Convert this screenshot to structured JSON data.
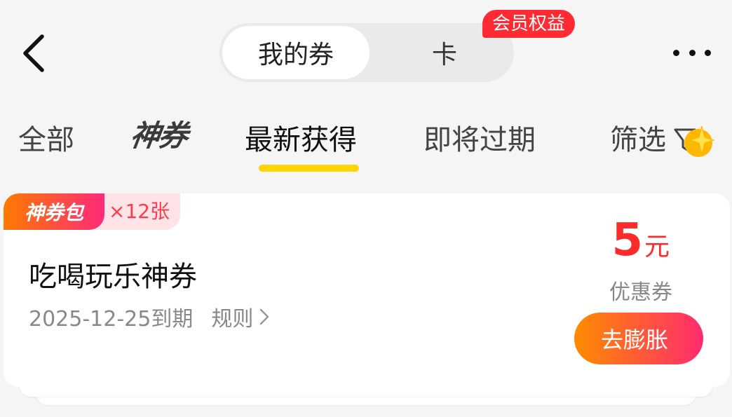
{
  "header": {
    "segments": [
      {
        "label": "我的券",
        "active": true
      },
      {
        "label": "卡",
        "active": false
      }
    ],
    "member_badge": "会员权益"
  },
  "filter_tabs": {
    "all": "全部",
    "god": "神券",
    "newest": "最新获得",
    "expiring": "即将过期",
    "filter": "筛选",
    "active": "最新获得"
  },
  "coupon": {
    "pack_label": "神券包",
    "pack_count": "×12张",
    "title": "吃喝玩乐神券",
    "expiry": "2025-12-25到期",
    "rules_label": "规则",
    "amount": "5",
    "amount_unit": "元",
    "type_label": "优惠券",
    "action_label": "去膨胀"
  },
  "colors": {
    "accent_yellow": "#ffd400",
    "price_red": "#ff2b2b",
    "badge_red": "#ff2b33",
    "gradient_start": "#ff8c00",
    "gradient_end": "#ff2b6e"
  },
  "icons": {
    "back": "chevron-left-icon",
    "more": "more-dots-icon",
    "filter": "funnel-icon",
    "rules": "chevron-right-icon",
    "sparkle": "sparkle-star-icon"
  }
}
